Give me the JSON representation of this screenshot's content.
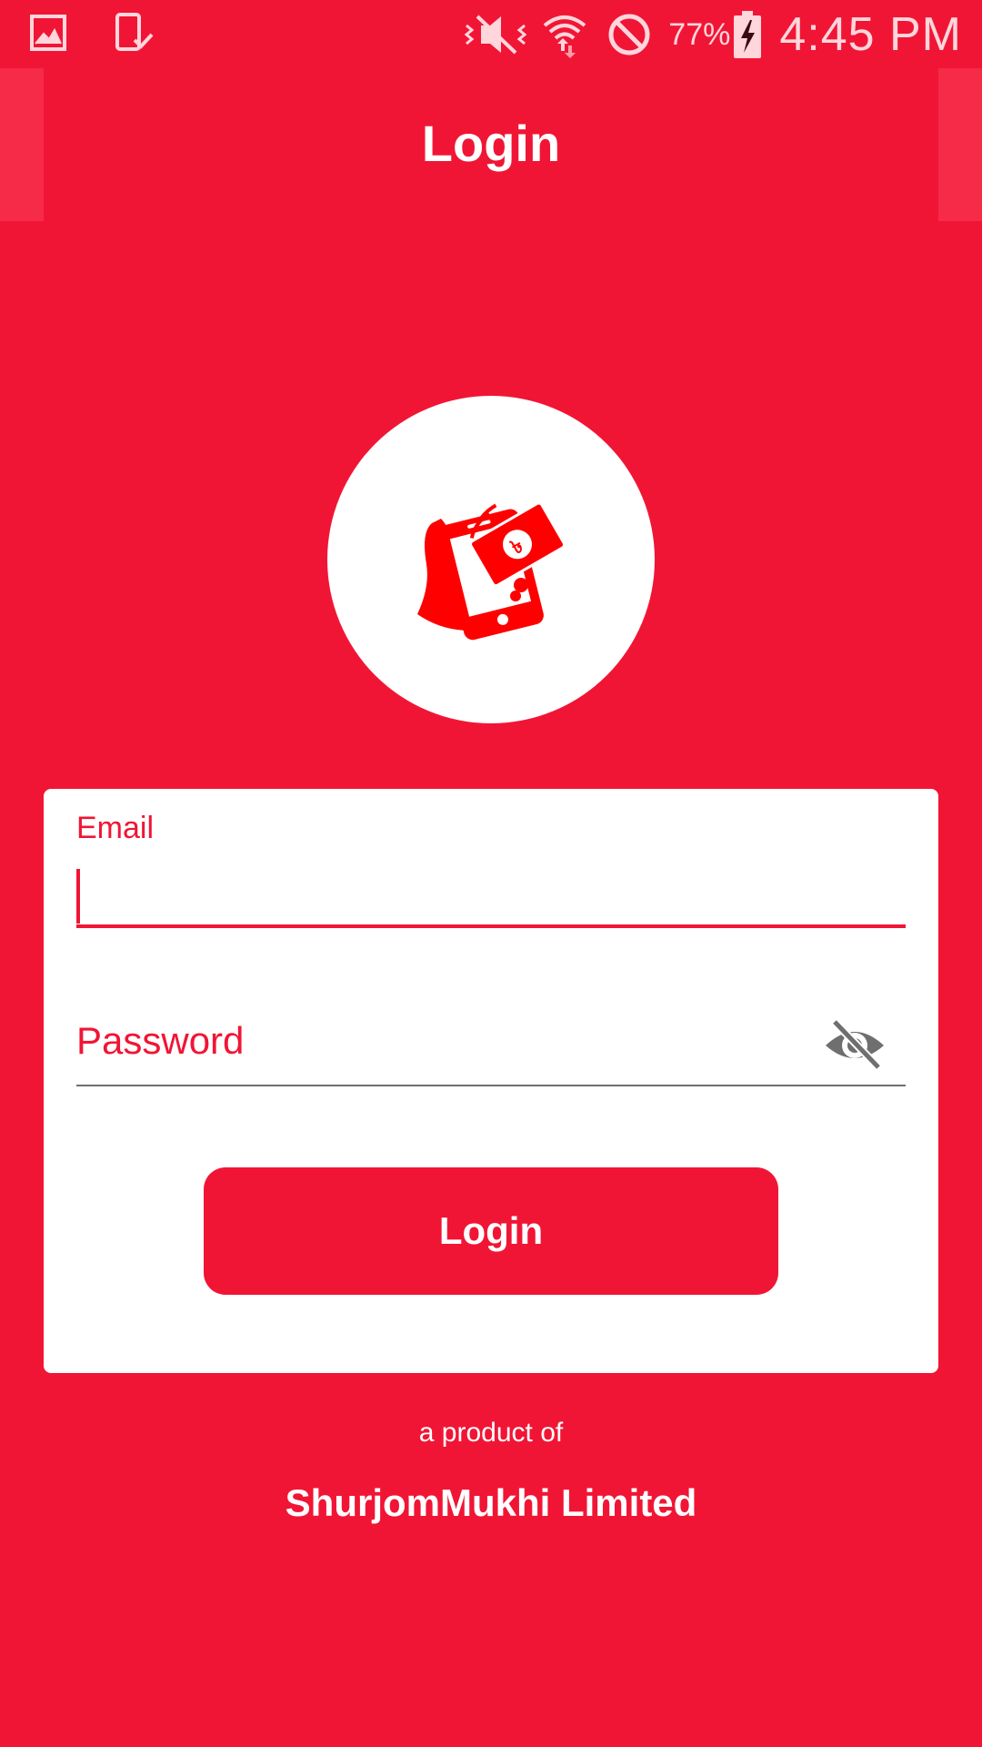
{
  "status_bar": {
    "battery_percent": "77%",
    "time": "4:45 PM",
    "icons": [
      "gallery-notification-icon",
      "device-check-notification-icon",
      "vibrate-mute-icon",
      "wifi-icon",
      "do-not-disturb-icon",
      "battery-charging-icon"
    ]
  },
  "app_bar": {
    "title": "Login"
  },
  "logo": {
    "icon": "mobile-wallet-icon"
  },
  "form": {
    "email_label": "Email",
    "email_value": "",
    "password_label": "Password",
    "password_value": "",
    "visibility_icon": "visibility-off-icon",
    "login_button": "Login"
  },
  "footer": {
    "tagline": "a product of",
    "company": "ShurjomMukhi Limited"
  },
  "colors": {
    "primary": "#f11535",
    "surface": "#ffffff",
    "icon_gray": "#6f6f6f"
  }
}
